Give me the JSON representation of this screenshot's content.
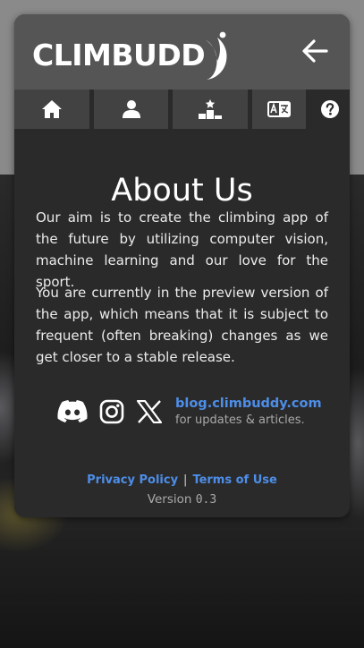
{
  "brand": {
    "name": "CLIMBUDD"
  },
  "tabs": [
    {
      "icon": "home-icon"
    },
    {
      "icon": "user-icon"
    },
    {
      "icon": "podium-icon"
    },
    {
      "icon": "language-icon"
    },
    {
      "icon": "help-icon",
      "active": true
    }
  ],
  "about": {
    "title": "About Us",
    "paragraph1": "Our aim is to create the climbing app of the future by utilizing computer vision, machine learning and our love for the sport.",
    "paragraph2": "You are currently in the preview version of the app, which means that it is subject to frequent (often breaking) changes as we get closer to a stable release."
  },
  "social": {
    "icons": [
      "discord-icon",
      "instagram-icon",
      "x-icon"
    ],
    "blog_link": "blog.climbuddy.com",
    "blog_subtitle": "for updates & articles."
  },
  "legal": {
    "privacy": "Privacy Policy",
    "separator": "|",
    "terms": "Terms of Use"
  },
  "version": {
    "label": "Version",
    "number": "0.3"
  },
  "colors": {
    "panel": "#2a2a2b",
    "header": "#555556",
    "tab": "#424243",
    "link": "#4d8ee8"
  }
}
